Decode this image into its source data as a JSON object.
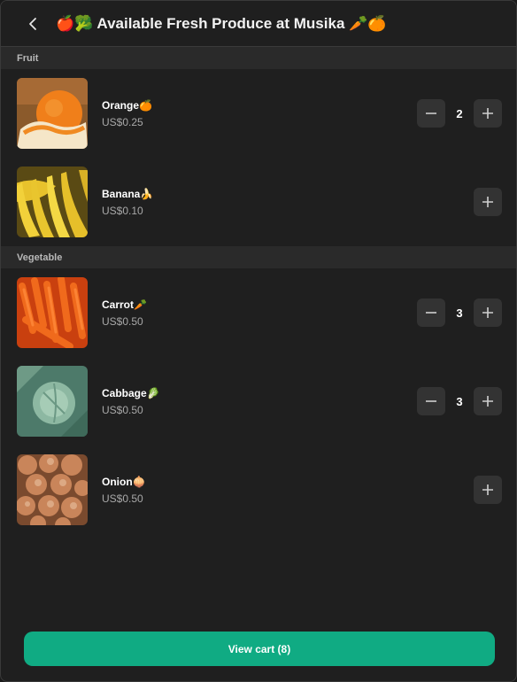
{
  "header": {
    "back_icon": "chevron-left-icon",
    "title": "🍎🥦 Available Fresh Produce at Musika 🥕🍊"
  },
  "sections": [
    {
      "label": "Fruit",
      "items": [
        {
          "name": "Orange🍊",
          "price": "US$0.25",
          "quantity": "2",
          "image": "orange-photo"
        },
        {
          "name": "Banana🍌",
          "price": "US$0.10",
          "quantity": null,
          "image": "banana-photo"
        }
      ]
    },
    {
      "label": "Vegetable",
      "items": [
        {
          "name": "Carrot🥕",
          "price": "US$0.50",
          "quantity": "3",
          "image": "carrot-photo"
        },
        {
          "name": "Cabbage🥬",
          "price": "US$0.50",
          "quantity": "3",
          "image": "cabbage-photo"
        },
        {
          "name": "Onion🧅",
          "price": "US$0.50",
          "quantity": null,
          "image": "onion-photo"
        }
      ]
    }
  ],
  "icons": {
    "decrement": "minus-icon",
    "increment": "plus-icon"
  },
  "footer": {
    "view_cart_label": "View cart (8)"
  },
  "colors": {
    "accent": "#10ab83",
    "background": "#1f1f1f",
    "section_bg": "#2a2a2a",
    "control_bg": "#333333"
  }
}
